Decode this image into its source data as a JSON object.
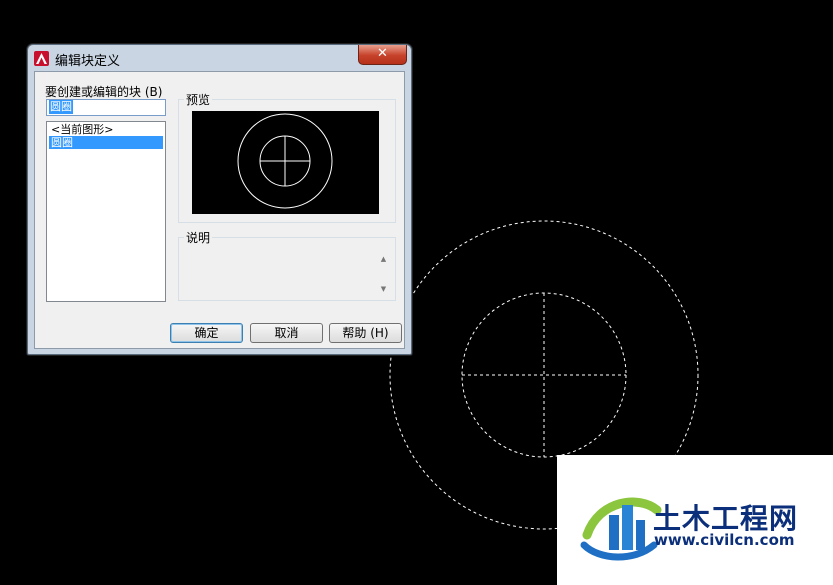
{
  "dialog": {
    "title": "编辑块定义",
    "close_label": "✕",
    "blocks_label": "要创建或编辑的块 (B)",
    "block_name_value": "圆圈",
    "block_list": [
      "<当前图形>",
      "圆圈"
    ],
    "selected_index": 1,
    "preview_label": "预览",
    "description_label": "说明",
    "ok_label": "确定",
    "cancel_label": "取消",
    "help_label": "帮助 (H)"
  },
  "canvas": {
    "entity_style": "dashed-selected",
    "colors": {
      "background": "#000000",
      "entity": "#ffffff"
    }
  },
  "watermark": {
    "name": "土木工程网",
    "url": "www.civilcn.com"
  }
}
